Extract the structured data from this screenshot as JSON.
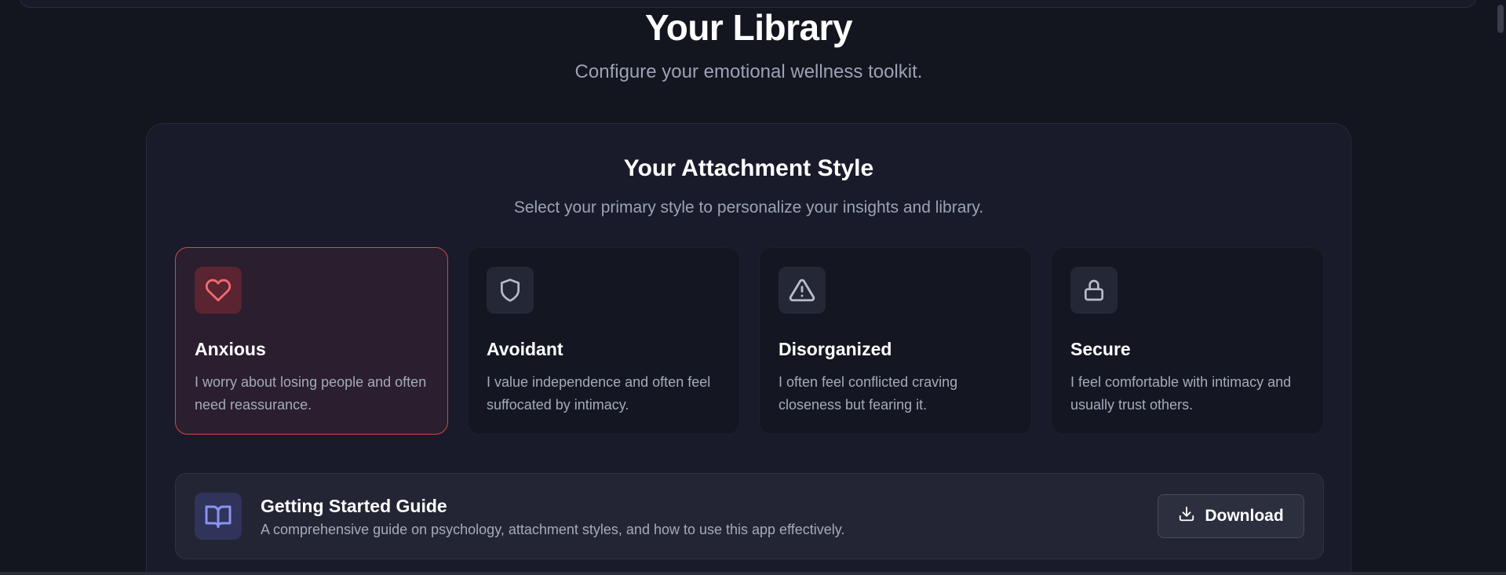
{
  "header": {
    "title": "Your Library",
    "subtitle": "Configure your emotional wellness toolkit."
  },
  "attachment": {
    "title": "Your Attachment Style",
    "subtitle": "Select your primary style to personalize your insights and library.",
    "selected": "Anxious",
    "cards": [
      {
        "name": "Anxious",
        "description": "I worry about losing people and often need reassurance.",
        "icon": "heart-icon",
        "selected": true
      },
      {
        "name": "Avoidant",
        "description": "I value independence and often feel suffocated by intimacy.",
        "icon": "shield-icon",
        "selected": false
      },
      {
        "name": "Disorganized",
        "description": "I often feel conflicted craving closeness but fearing it.",
        "icon": "warning-triangle-icon",
        "selected": false
      },
      {
        "name": "Secure",
        "description": "I feel comfortable with intimacy and usually trust others.",
        "icon": "lock-icon",
        "selected": false
      }
    ]
  },
  "guide": {
    "title": "Getting Started Guide",
    "description": "A comprehensive guide on psychology, attachment styles, and how to use this app effectively.",
    "icon": "book-icon",
    "button_label": "Download"
  },
  "colors": {
    "background": "#13151f",
    "panel": "#191b2b",
    "accent_selected": "#d3484d",
    "guide_icon": "#8b93f0"
  }
}
